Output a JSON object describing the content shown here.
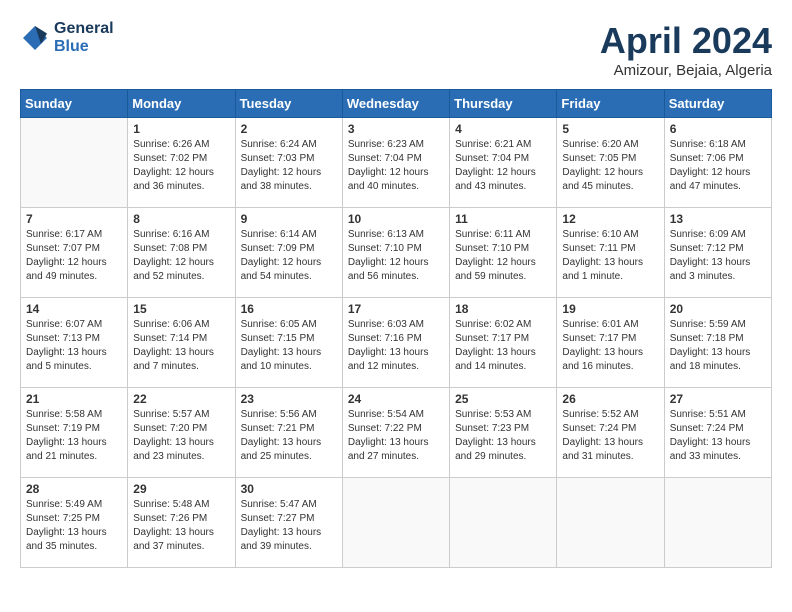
{
  "header": {
    "logo_line1": "General",
    "logo_line2": "Blue",
    "month_title": "April 2024",
    "location": "Amizour, Bejaia, Algeria"
  },
  "days_of_week": [
    "Sunday",
    "Monday",
    "Tuesday",
    "Wednesday",
    "Thursday",
    "Friday",
    "Saturday"
  ],
  "weeks": [
    [
      {
        "day": "",
        "info": ""
      },
      {
        "day": "1",
        "info": "Sunrise: 6:26 AM\nSunset: 7:02 PM\nDaylight: 12 hours\nand 36 minutes."
      },
      {
        "day": "2",
        "info": "Sunrise: 6:24 AM\nSunset: 7:03 PM\nDaylight: 12 hours\nand 38 minutes."
      },
      {
        "day": "3",
        "info": "Sunrise: 6:23 AM\nSunset: 7:04 PM\nDaylight: 12 hours\nand 40 minutes."
      },
      {
        "day": "4",
        "info": "Sunrise: 6:21 AM\nSunset: 7:04 PM\nDaylight: 12 hours\nand 43 minutes."
      },
      {
        "day": "5",
        "info": "Sunrise: 6:20 AM\nSunset: 7:05 PM\nDaylight: 12 hours\nand 45 minutes."
      },
      {
        "day": "6",
        "info": "Sunrise: 6:18 AM\nSunset: 7:06 PM\nDaylight: 12 hours\nand 47 minutes."
      }
    ],
    [
      {
        "day": "7",
        "info": "Sunrise: 6:17 AM\nSunset: 7:07 PM\nDaylight: 12 hours\nand 49 minutes."
      },
      {
        "day": "8",
        "info": "Sunrise: 6:16 AM\nSunset: 7:08 PM\nDaylight: 12 hours\nand 52 minutes."
      },
      {
        "day": "9",
        "info": "Sunrise: 6:14 AM\nSunset: 7:09 PM\nDaylight: 12 hours\nand 54 minutes."
      },
      {
        "day": "10",
        "info": "Sunrise: 6:13 AM\nSunset: 7:10 PM\nDaylight: 12 hours\nand 56 minutes."
      },
      {
        "day": "11",
        "info": "Sunrise: 6:11 AM\nSunset: 7:10 PM\nDaylight: 12 hours\nand 59 minutes."
      },
      {
        "day": "12",
        "info": "Sunrise: 6:10 AM\nSunset: 7:11 PM\nDaylight: 13 hours\nand 1 minute."
      },
      {
        "day": "13",
        "info": "Sunrise: 6:09 AM\nSunset: 7:12 PM\nDaylight: 13 hours\nand 3 minutes."
      }
    ],
    [
      {
        "day": "14",
        "info": "Sunrise: 6:07 AM\nSunset: 7:13 PM\nDaylight: 13 hours\nand 5 minutes."
      },
      {
        "day": "15",
        "info": "Sunrise: 6:06 AM\nSunset: 7:14 PM\nDaylight: 13 hours\nand 7 minutes."
      },
      {
        "day": "16",
        "info": "Sunrise: 6:05 AM\nSunset: 7:15 PM\nDaylight: 13 hours\nand 10 minutes."
      },
      {
        "day": "17",
        "info": "Sunrise: 6:03 AM\nSunset: 7:16 PM\nDaylight: 13 hours\nand 12 minutes."
      },
      {
        "day": "18",
        "info": "Sunrise: 6:02 AM\nSunset: 7:17 PM\nDaylight: 13 hours\nand 14 minutes."
      },
      {
        "day": "19",
        "info": "Sunrise: 6:01 AM\nSunset: 7:17 PM\nDaylight: 13 hours\nand 16 minutes."
      },
      {
        "day": "20",
        "info": "Sunrise: 5:59 AM\nSunset: 7:18 PM\nDaylight: 13 hours\nand 18 minutes."
      }
    ],
    [
      {
        "day": "21",
        "info": "Sunrise: 5:58 AM\nSunset: 7:19 PM\nDaylight: 13 hours\nand 21 minutes."
      },
      {
        "day": "22",
        "info": "Sunrise: 5:57 AM\nSunset: 7:20 PM\nDaylight: 13 hours\nand 23 minutes."
      },
      {
        "day": "23",
        "info": "Sunrise: 5:56 AM\nSunset: 7:21 PM\nDaylight: 13 hours\nand 25 minutes."
      },
      {
        "day": "24",
        "info": "Sunrise: 5:54 AM\nSunset: 7:22 PM\nDaylight: 13 hours\nand 27 minutes."
      },
      {
        "day": "25",
        "info": "Sunrise: 5:53 AM\nSunset: 7:23 PM\nDaylight: 13 hours\nand 29 minutes."
      },
      {
        "day": "26",
        "info": "Sunrise: 5:52 AM\nSunset: 7:24 PM\nDaylight: 13 hours\nand 31 minutes."
      },
      {
        "day": "27",
        "info": "Sunrise: 5:51 AM\nSunset: 7:24 PM\nDaylight: 13 hours\nand 33 minutes."
      }
    ],
    [
      {
        "day": "28",
        "info": "Sunrise: 5:49 AM\nSunset: 7:25 PM\nDaylight: 13 hours\nand 35 minutes."
      },
      {
        "day": "29",
        "info": "Sunrise: 5:48 AM\nSunset: 7:26 PM\nDaylight: 13 hours\nand 37 minutes."
      },
      {
        "day": "30",
        "info": "Sunrise: 5:47 AM\nSunset: 7:27 PM\nDaylight: 13 hours\nand 39 minutes."
      },
      {
        "day": "",
        "info": ""
      },
      {
        "day": "",
        "info": ""
      },
      {
        "day": "",
        "info": ""
      },
      {
        "day": "",
        "info": ""
      }
    ]
  ]
}
